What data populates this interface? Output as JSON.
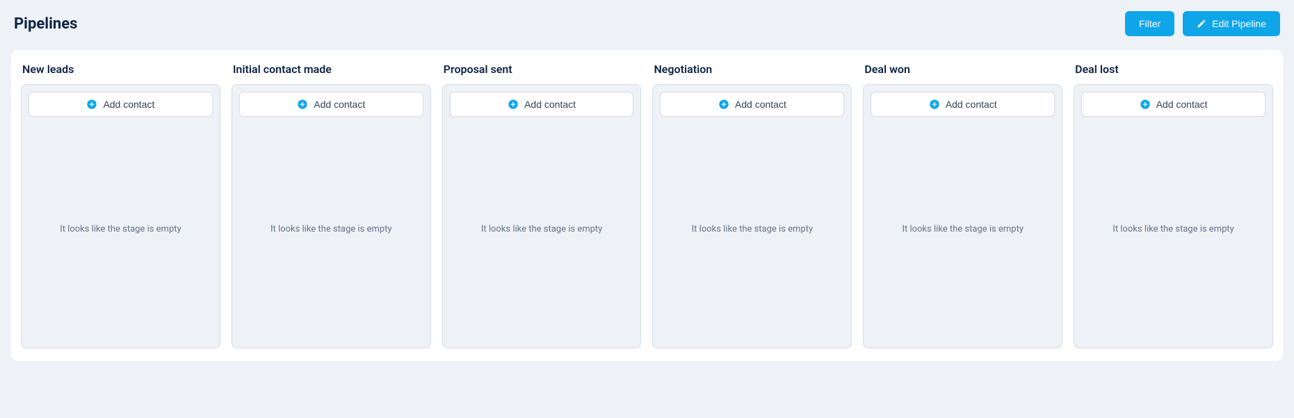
{
  "header": {
    "title": "Pipelines",
    "filter_label": "Filter",
    "edit_label": "Edit Pipeline"
  },
  "add_contact_label": "Add contact",
  "empty_stage_text": "It looks like the stage is empty",
  "columns": [
    {
      "title": "New leads"
    },
    {
      "title": "Initial contact made"
    },
    {
      "title": "Proposal sent"
    },
    {
      "title": "Negotiation"
    },
    {
      "title": "Deal won"
    },
    {
      "title": "Deal lost"
    }
  ]
}
